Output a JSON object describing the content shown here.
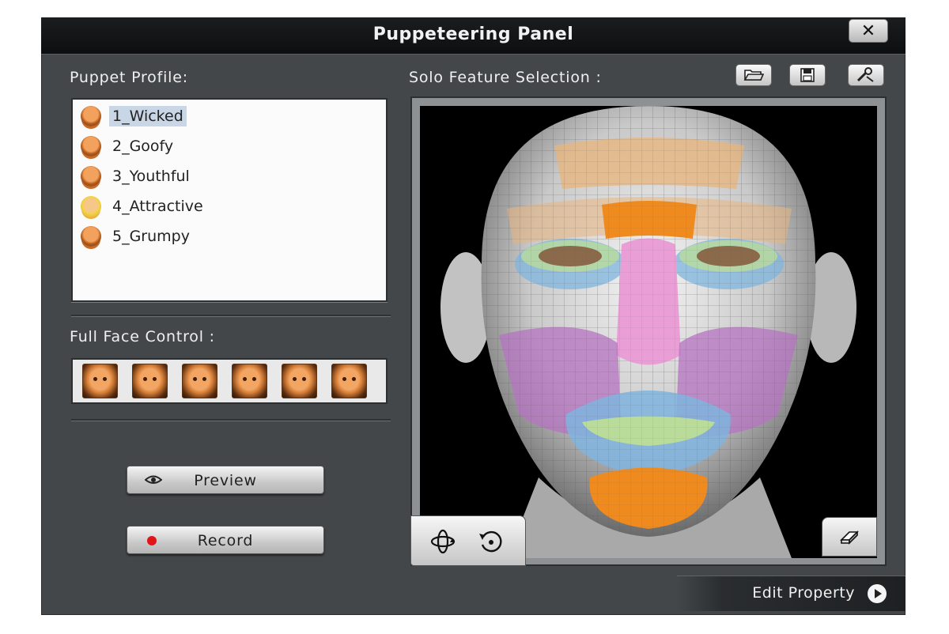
{
  "window": {
    "title": "Puppeteering Panel",
    "close_label": "✕"
  },
  "puppet_profile": {
    "label": "Puppet Profile:",
    "items": [
      {
        "label": "1_Wicked",
        "selected": true
      },
      {
        "label": "2_Goofy",
        "selected": false
      },
      {
        "label": "3_Youthful",
        "selected": false
      },
      {
        "label": "4_Attractive",
        "selected": false
      },
      {
        "label": "5_Grumpy",
        "selected": false
      }
    ]
  },
  "full_face_control": {
    "label": "Full Face Control :",
    "thumbnail_count": 6
  },
  "buttons": {
    "preview": "Preview",
    "record": "Record"
  },
  "solo_feature": {
    "label": "Solo Feature Selection :",
    "tools": [
      "open-folder-icon",
      "save-disk-icon",
      "settings-tool-icon"
    ],
    "viewport_tools": [
      "rotate-view-icon",
      "reset-view-icon",
      "eraser-icon"
    ]
  },
  "footer": {
    "edit_property": "Edit Property"
  },
  "colors": {
    "panel_bg": "#43474a",
    "titlebar": "#121314",
    "record_dot": "#e0151a",
    "forehead_zone": "#e8b47c",
    "nose_bridge_zone": "#ef8a1e",
    "nose_zone": "#e99fd6",
    "cheek_zone": "#b673c0",
    "mouth_zone": "#7fb4de",
    "lips_zone": "#b9dc9a",
    "chin_zone": "#ef8a1e"
  }
}
